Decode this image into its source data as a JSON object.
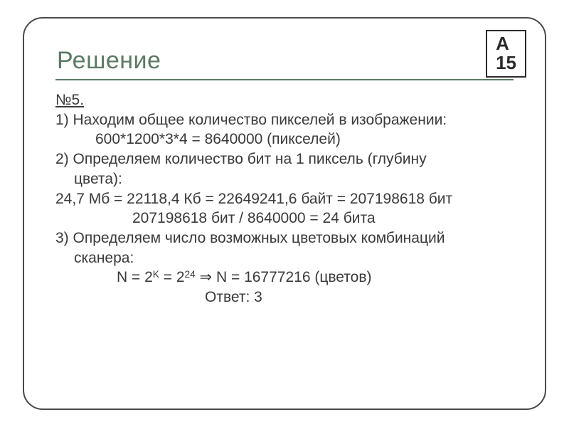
{
  "badge": {
    "line1": "А",
    "line2": "15"
  },
  "title": "Решение",
  "problem_label": "№5.",
  "lines": {
    "l1": "1) Находим общее количество пикселей в изображении:",
    "l2": "600*1200*3*4 = 8640000 (пикселей)",
    "l3": "2) Определяем количество бит на 1 пиксель (глубину",
    "l3b": "цвета):",
    "l4": "24,7 Мб = 22118,4 Кб = 22649241,6 байт = 207198618 бит",
    "l5": "207198618 бит / 8640000 = 24 бита",
    "l6": "3) Определяем число возможных цветовых комбинаций",
    "l7": "сканера:",
    "formula_pre": "N = 2",
    "formula_exp1": "K",
    "formula_mid": " = 2",
    "formula_exp2": "24",
    "formula_post": "   ⇒ N = 16777216 (цветов)",
    "answer": "Ответ: 3"
  }
}
